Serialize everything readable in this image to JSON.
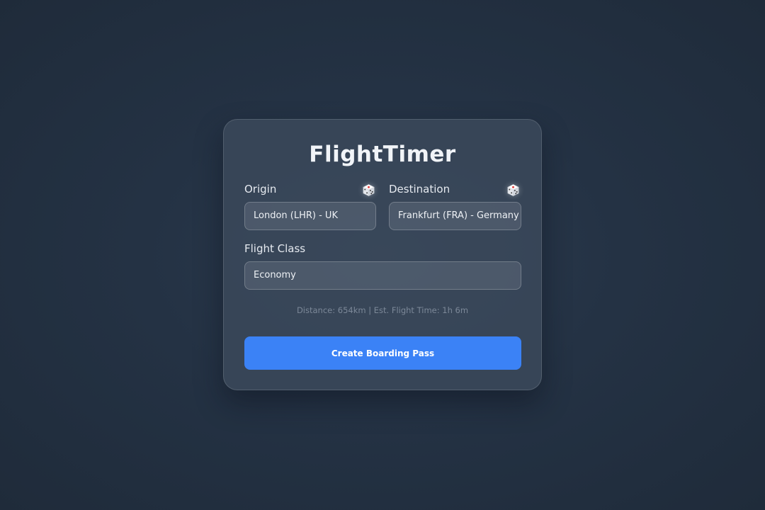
{
  "app": {
    "title": "FlightTimer"
  },
  "form": {
    "origin": {
      "label": "Origin",
      "value": "London (LHR) - UK",
      "random_icon": "dice-icon"
    },
    "destination": {
      "label": "Destination",
      "value": "Frankfurt (FRA) - Germany",
      "random_icon": "dice-icon"
    },
    "flight_class": {
      "label": "Flight Class",
      "value": "Economy"
    },
    "info": "Distance: 654km | Est. Flight Time: 1h 6m",
    "submit_label": "Create Boarding Pass"
  },
  "colors": {
    "accent": "#3b82f6",
    "background": "#243244",
    "card": "#3e4c5e"
  }
}
